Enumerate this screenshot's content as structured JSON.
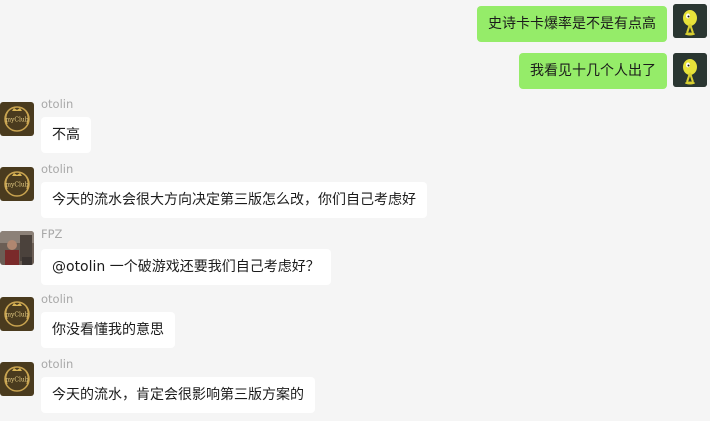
{
  "messages": [
    {
      "side": "out",
      "text": "史诗卡卡爆率是不是有点高",
      "avatar": "yellow-bird-avatar"
    },
    {
      "side": "out",
      "text": "我看见十几个人出了",
      "avatar": "yellow-bird-avatar"
    },
    {
      "side": "in",
      "sender": "otolin",
      "text": "不高",
      "avatar": "myclub-crest-avatar"
    },
    {
      "side": "in",
      "sender": "otolin",
      "text": "今天的流水会很大方向决定第三版怎么改，你们自己考虑好",
      "avatar": "myclub-crest-avatar"
    },
    {
      "side": "in",
      "sender": "FPZ",
      "text": "@otolin 一个破游戏还要我们自己考虑好？",
      "avatar": "photo-avatar"
    },
    {
      "side": "in",
      "sender": "otolin",
      "text": "你没看懂我的意思",
      "avatar": "myclub-crest-avatar"
    },
    {
      "side": "in",
      "sender": "otolin",
      "text": "今天的流水，肯定会很影响第三版方案的",
      "avatar": "myclub-crest-avatar"
    }
  ],
  "avatar_text": {
    "crest": "myClub"
  },
  "colors": {
    "background": "#f5f5f5",
    "outgoing_bubble": "#95ec69",
    "incoming_bubble": "#ffffff",
    "sender_name": "#a8a8a8"
  }
}
